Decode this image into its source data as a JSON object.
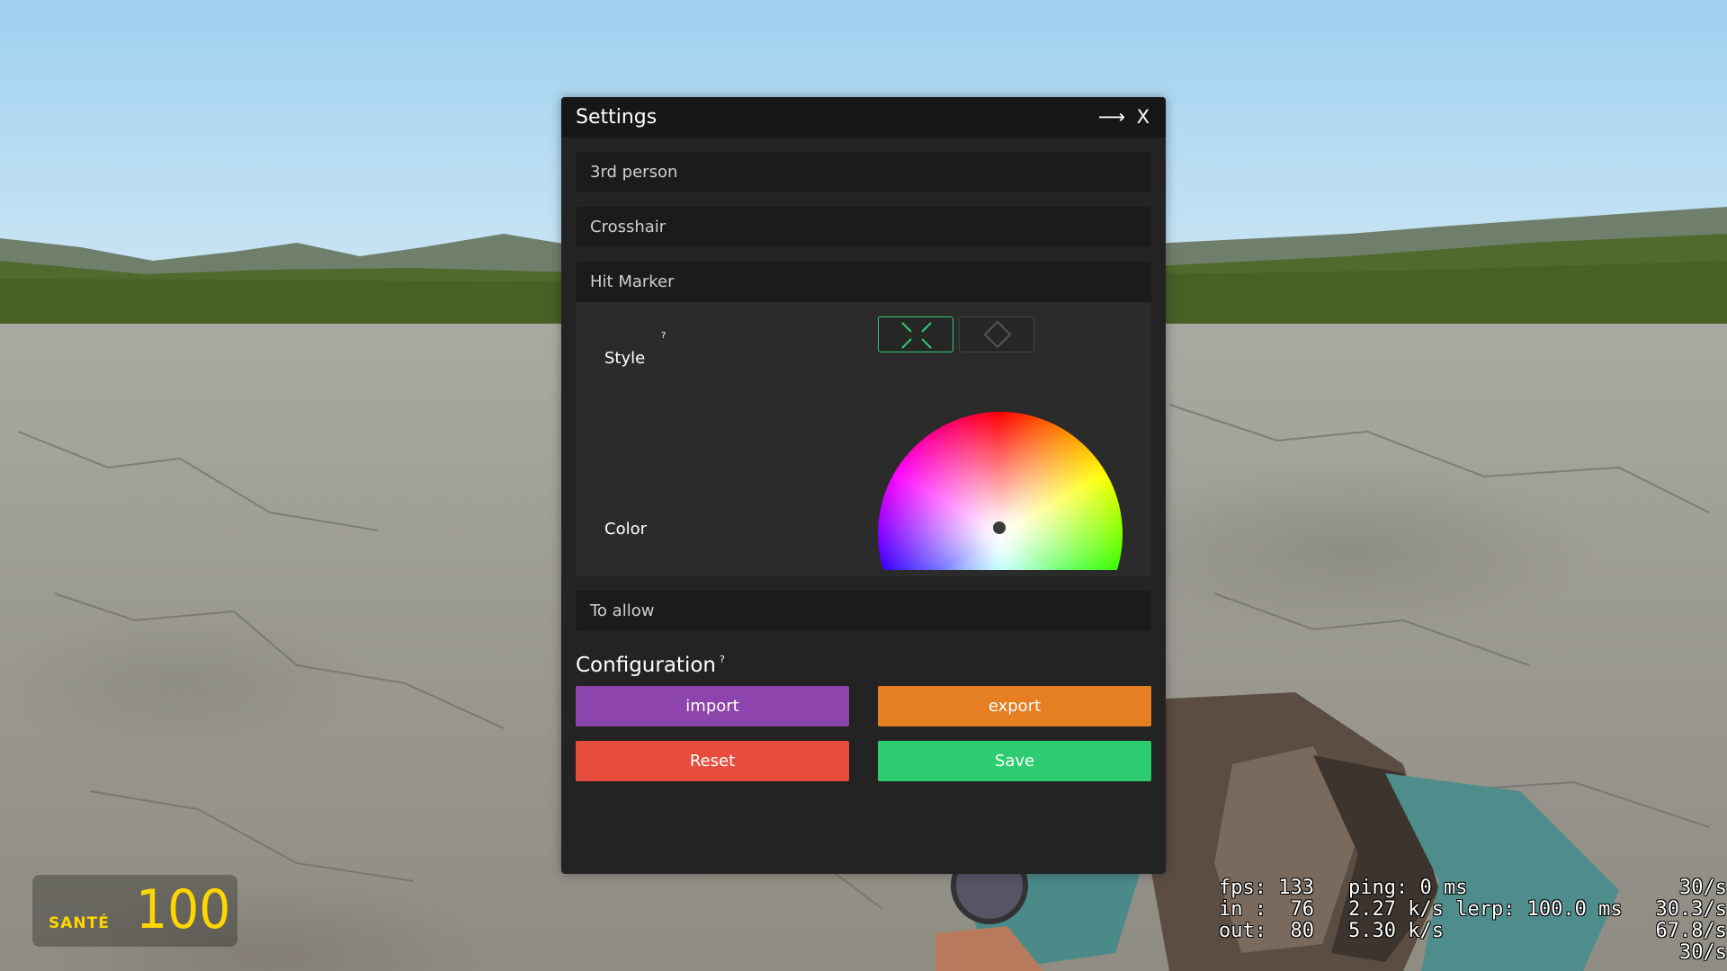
{
  "panel": {
    "title": "Settings",
    "arrow_glyph": "⟶",
    "close_label": "X"
  },
  "sections": [
    {
      "label": "3rd person"
    },
    {
      "label": "Crosshair"
    },
    {
      "label": "Hit Marker"
    },
    {
      "label": "To allow"
    }
  ],
  "hit_marker": {
    "style_label": "Style",
    "style_help": "?",
    "color_label": "Color",
    "style_options": [
      "cross-icon",
      "diamond-icon"
    ],
    "selected_style": "cross-icon"
  },
  "configuration": {
    "title": "Configuration",
    "help": "?",
    "import_label": "import",
    "export_label": "export",
    "reset_label": "Reset",
    "save_label": "Save"
  },
  "colors": {
    "import": "#8e44ad",
    "export": "#e67e22",
    "reset": "#e74c3c",
    "save": "#2ecc71",
    "selected_border": "#2ecc71",
    "hud_yellow": "#ffd600"
  },
  "hud": {
    "health_label": "SANTÉ",
    "health_value": "100",
    "net_col1": [
      "fps: 133",
      "in :  76",
      "out:  80"
    ],
    "net_col2": [
      "ping: 0 ms",
      "2.27 k/s lerp: 100.0 ms",
      "5.30 k/s"
    ],
    "net_col3": [
      "30/s",
      "30.3/s",
      "67.8/s",
      "30/s"
    ]
  }
}
